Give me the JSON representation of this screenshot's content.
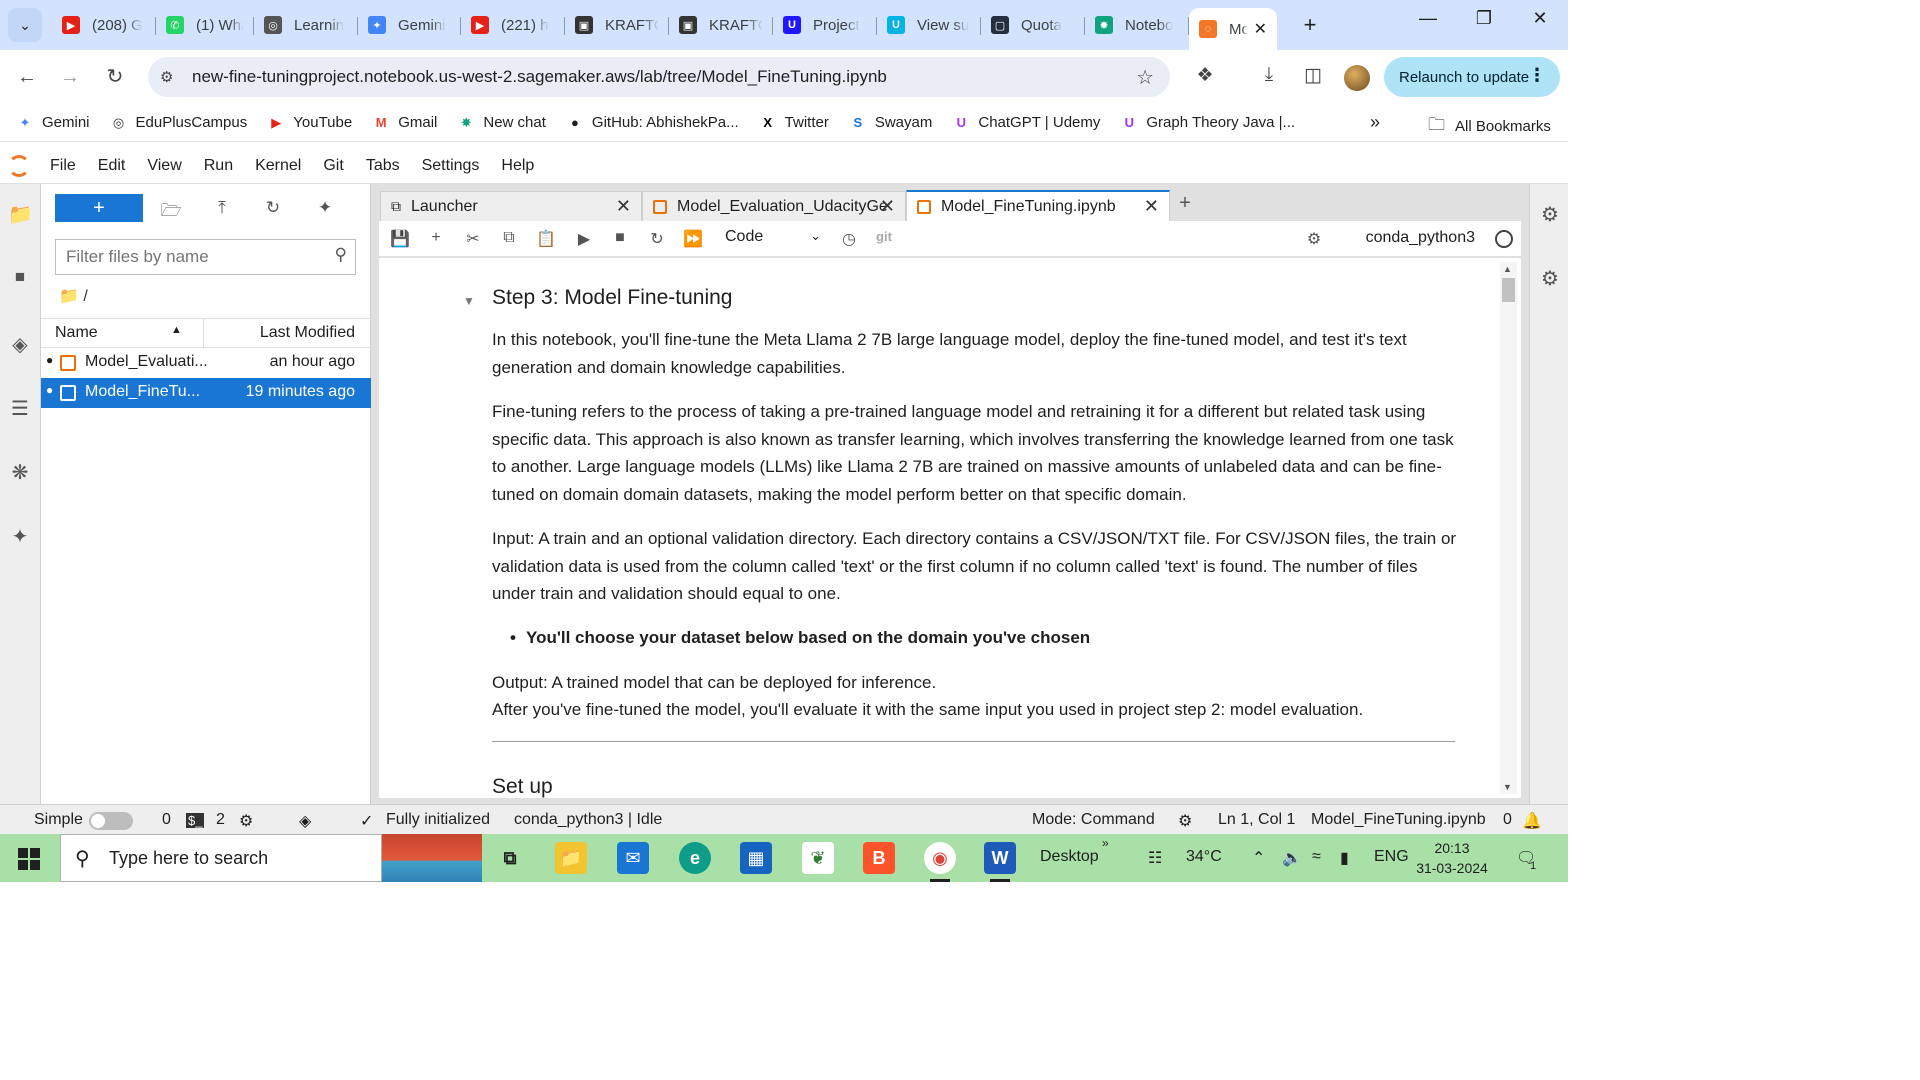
{
  "browser": {
    "tabs": [
      {
        "label": "(208) G",
        "icon": "youtube-icon",
        "color": "#e62117"
      },
      {
        "label": "(1) Wha",
        "icon": "whatsapp-icon",
        "color": "#25d366"
      },
      {
        "label": "Learnin",
        "icon": "globe-icon",
        "color": "#555555"
      },
      {
        "label": "Gemini",
        "icon": "gemini-icon",
        "color": "#4285f4"
      },
      {
        "label": "(221) h",
        "icon": "youtube-icon",
        "color": "#e62117"
      },
      {
        "label": "KRAFTO",
        "icon": "krafton-icon",
        "color": "#333333"
      },
      {
        "label": "KRAFTO",
        "icon": "krafton-icon",
        "color": "#333333"
      },
      {
        "label": "Project",
        "icon": "udacity-icon",
        "color": "#2015ff"
      },
      {
        "label": "View su",
        "icon": "udacity-icon",
        "color": "#02b3e4"
      },
      {
        "label": "Quota",
        "icon": "aws-icon",
        "color": "#232f3e"
      },
      {
        "label": "Notebo",
        "icon": "openai-icon",
        "color": "#10a37f"
      },
      {
        "label": "Mo",
        "icon": "jupyter-icon",
        "color": "#f37726",
        "active": true
      }
    ],
    "url": "new-fine-tuningproject.notebook.us-west-2.sagemaker.aws/lab/tree/Model_FineTuning.ipynb",
    "relaunch_label": "Relaunch to update",
    "bookmarks": [
      {
        "label": "Gemini",
        "icon": "gemini-icon",
        "color": "#4285f4"
      },
      {
        "label": "EduPlusCampus",
        "icon": "globe-icon",
        "color": "#333333"
      },
      {
        "label": "YouTube",
        "icon": "youtube-icon",
        "color": "#e62117"
      },
      {
        "label": "Gmail",
        "icon": "gmail-icon",
        "color": "#ea4335"
      },
      {
        "label": "New chat",
        "icon": "openai-icon",
        "color": "#10a37f"
      },
      {
        "label": "GitHub: AbhishekPa...",
        "icon": "github-icon",
        "color": "#1f1f1f"
      },
      {
        "label": "Twitter",
        "icon": "x-icon",
        "color": "#000000"
      },
      {
        "label": "Swayam",
        "icon": "swayam-icon",
        "color": "#1a73e8"
      },
      {
        "label": "ChatGPT | Udemy",
        "icon": "udemy-icon",
        "color": "#a435f0"
      },
      {
        "label": "Graph Theory Java |...",
        "icon": "udemy-icon",
        "color": "#a435f0"
      }
    ],
    "all_bookmarks_label": "All Bookmarks"
  },
  "jupyter": {
    "menu": [
      "File",
      "Edit",
      "View",
      "Run",
      "Kernel",
      "Git",
      "Tabs",
      "Settings",
      "Help"
    ],
    "filebrowser": {
      "filter_placeholder": "Filter files by name",
      "breadcrumb": "/",
      "col_name": "Name",
      "col_modified": "Last Modified",
      "files": [
        {
          "name": "Model_Evaluati...",
          "modified": "an hour ago",
          "selected": false
        },
        {
          "name": "Model_FineTu...",
          "modified": "19 minutes ago",
          "selected": true
        }
      ]
    },
    "doc_tabs": [
      {
        "label": "Launcher"
      },
      {
        "label": "Model_Evaluation_UdacityGe"
      },
      {
        "label": "Model_FineTuning.ipynb",
        "active": true
      }
    ],
    "toolbar": {
      "cell_type": "Code",
      "git_label": "git",
      "kernel": "conda_python3"
    },
    "notebook": {
      "heading": "Step 3: Model Fine-tuning",
      "p1": "In this notebook, you'll fine-tune the Meta Llama 2 7B large language model, deploy the fine-tuned model, and test it's text generation and domain knowledge capabilities.",
      "p2": "Fine-tuning refers to the process of taking a pre-trained language model and retraining it for a different but related task using specific data. This approach is also known as transfer learning, which involves transferring the knowledge learned from one task to another. Large language models (LLMs) like Llama 2 7B are trained on massive amounts of unlabeled data and can be fine-tuned on domain domain datasets, making the model perform better on that specific domain.",
      "p3": "Input: A train and an optional validation directory. Each directory contains a CSV/JSON/TXT file. For CSV/JSON files, the train or validation data is used from the column called 'text' or the first column if no column called 'text' is found. The number of files under train and validation should equal to one.",
      "bullet": "You'll choose your dataset below based on the domain you've chosen",
      "p4a": "Output: A trained model that can be deployed for inference.",
      "p4b": "After you've fine-tuned the model, you'll evaluate it with the same input you used in project step 2: model evaluation.",
      "heading2": "Set up"
    },
    "status": {
      "simple": "Simple",
      "terminals": "0",
      "kernels": "2",
      "init": "Fully initialized",
      "kernel_state": "conda_python3 | Idle",
      "mode": "Mode: Command",
      "cursor": "Ln 1, Col 1",
      "file": "Model_FineTuning.ipynb",
      "notifications": "0"
    }
  },
  "taskbar": {
    "search_placeholder": "Type here to search",
    "desktop_label": "Desktop",
    "temperature": "34°C",
    "language": "ENG",
    "time": "20:13",
    "date": "31-03-2024",
    "notif_count": "1"
  }
}
